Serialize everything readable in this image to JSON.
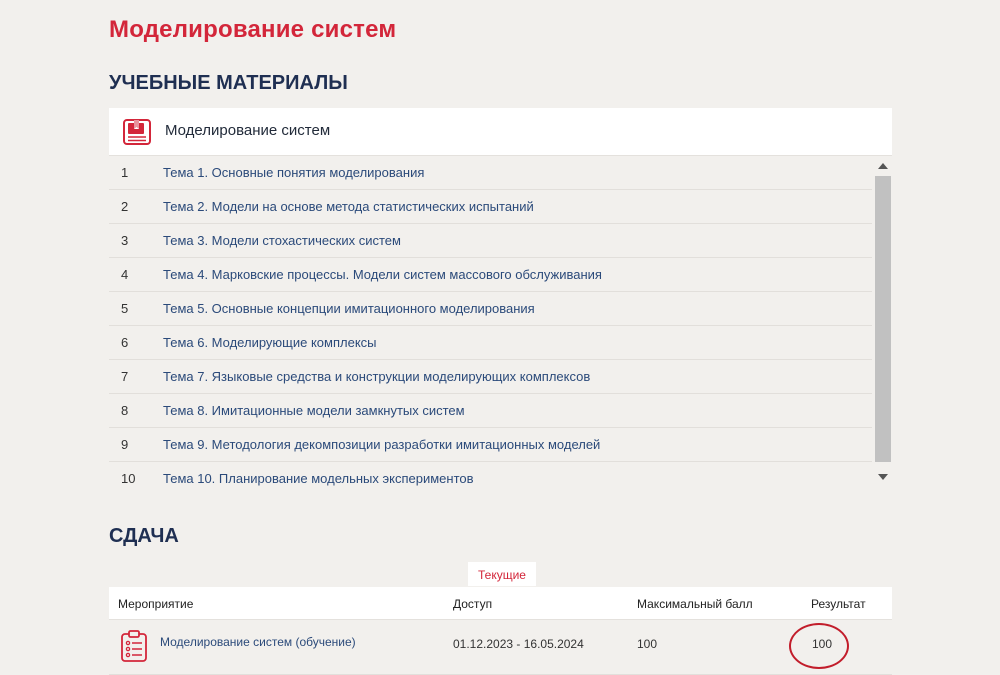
{
  "page_title": "Моделирование систем",
  "materials": {
    "section_title": "УЧЕБНЫЕ МАТЕРИАЛЫ",
    "card_title": "Моделирование систем",
    "card_icon": "book-icon",
    "topics": [
      {
        "num": "1",
        "label": "Тема 1. Основные понятия моделирования"
      },
      {
        "num": "2",
        "label": "Тема 2. Модели на основе метода статистических испытаний"
      },
      {
        "num": "3",
        "label": "Тема 3. Модели стохастических систем"
      },
      {
        "num": "4",
        "label": "Тема 4. Марковские процессы. Модели систем массового обслуживания"
      },
      {
        "num": "5",
        "label": "Тема 5. Основные концепции имитационного моделирования"
      },
      {
        "num": "6",
        "label": "Тема 6. Моделирующие комплексы"
      },
      {
        "num": "7",
        "label": "Тема 7. Языковые средства и конструкции моделирующих комплексов"
      },
      {
        "num": "8",
        "label": "Тема 8. Имитационные модели замкнутых систем"
      },
      {
        "num": "9",
        "label": "Тема 9. Методология декомпозиции разработки имитационных моделей"
      },
      {
        "num": "10",
        "label": "Тема 10. Планирование модельных экспериментов"
      }
    ]
  },
  "sdacha": {
    "section_title": "СДАЧА",
    "tab_label": "Текущие",
    "columns": {
      "event": "Мероприятие",
      "access": "Доступ",
      "max_score": "Максимальный балл",
      "result": "Результат"
    },
    "rows": [
      {
        "event": "Моделирование систем (обучение)",
        "access": "01.12.2023 - 16.05.2024",
        "max_score": "100",
        "result": "100",
        "icon": "clipboard-list-icon"
      }
    ]
  },
  "colors": {
    "accent_red": "#d3263a",
    "heading_navy": "#1f2f52",
    "link_blue": "#2b4a7a",
    "background": "#f2f0ed"
  }
}
